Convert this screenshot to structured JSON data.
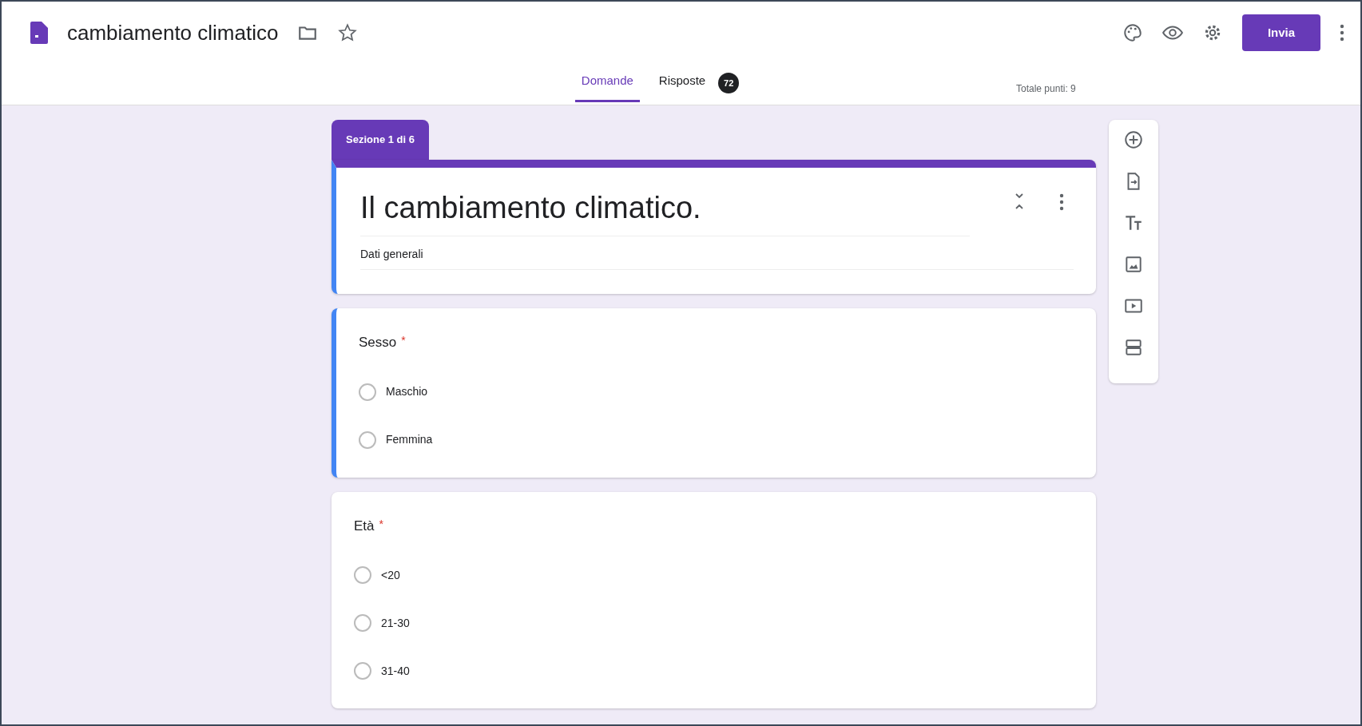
{
  "header": {
    "title": "cambiamento climatico",
    "send_button": "Invia"
  },
  "tabs": [
    {
      "label": "Domande",
      "selected": true
    },
    {
      "label": "Risposte",
      "selected": false,
      "badge": "72"
    }
  ],
  "total_points": "Totale punti: 9",
  "section": {
    "label": "Sezione 1 di 6",
    "title": "Il cambiamento climatico.",
    "description": "Dati generali",
    "focused": true
  },
  "questions": [
    {
      "title": "Sesso",
      "required_mark": "*",
      "focused": true,
      "options": [
        {
          "label": "Maschio",
          "selected": false
        },
        {
          "label": "Femmina",
          "selected": false
        }
      ]
    },
    {
      "title": "Età",
      "required_mark": "*",
      "focused": false,
      "options": [
        {
          "label": "<20",
          "selected": false
        },
        {
          "label": "21-30",
          "selected": false
        },
        {
          "label": "31-40",
          "selected": false
        }
      ]
    }
  ],
  "toolbar": [
    {
      "kind": "add"
    },
    {
      "kind": "import"
    },
    {
      "kind": "text"
    },
    {
      "kind": "image"
    },
    {
      "kind": "video"
    },
    {
      "kind": "section"
    }
  ]
}
